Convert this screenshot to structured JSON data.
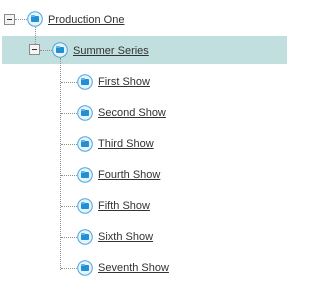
{
  "tree": {
    "root": {
      "label": "Production One",
      "icon": "folder-icon",
      "expanded": true
    },
    "series": {
      "label": "Summer Series",
      "icon": "folder-icon",
      "expanded": true,
      "selected": true
    },
    "shows": [
      {
        "label": "First Show",
        "icon": "folder-icon"
      },
      {
        "label": "Second Show",
        "icon": "folder-icon"
      },
      {
        "label": "Third Show",
        "icon": "folder-icon"
      },
      {
        "label": "Fourth Show",
        "icon": "folder-icon"
      },
      {
        "label": "Fifth Show",
        "icon": "folder-icon"
      },
      {
        "label": "Sixth Show",
        "icon": "folder-icon"
      },
      {
        "label": "Seventh Show",
        "icon": "folder-icon"
      }
    ]
  },
  "colors": {
    "selected_background": "#c1dfdf",
    "icon_blue": "#1f8fd6",
    "connector": "#8f8f8f"
  }
}
